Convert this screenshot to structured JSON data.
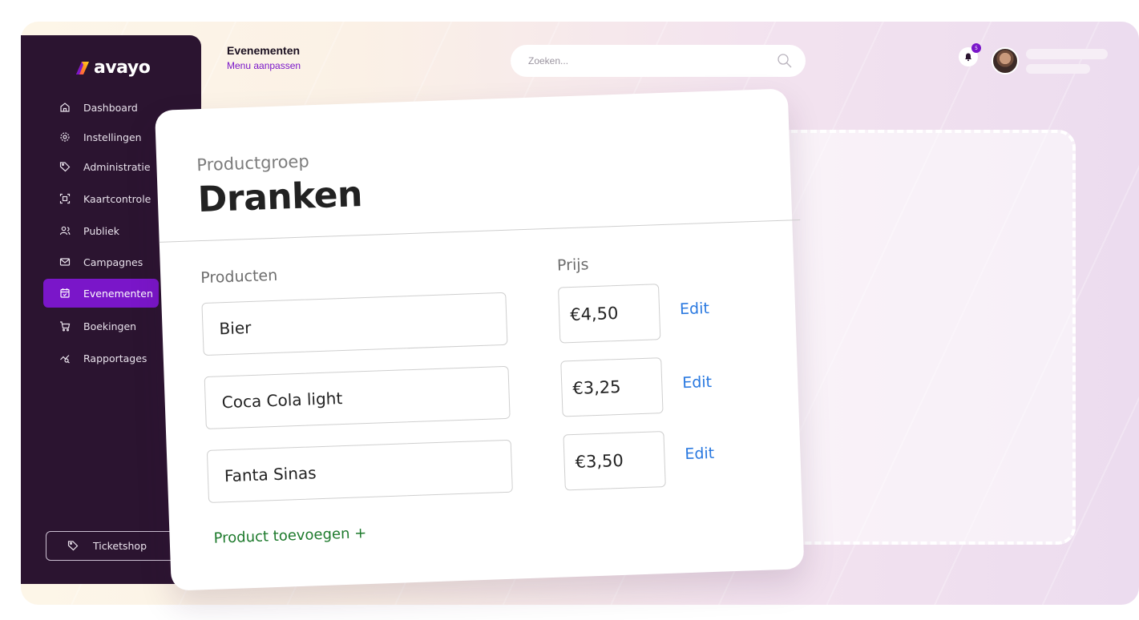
{
  "brand": {
    "name": "avayo"
  },
  "sidebar": {
    "items": [
      {
        "label": "Dashboard",
        "icon": "home-icon"
      },
      {
        "label": "Instellingen",
        "icon": "gear-icon"
      },
      {
        "label": "Administratie",
        "icon": "tag-icon"
      },
      {
        "label": "Kaartcontrole",
        "icon": "scan-icon"
      },
      {
        "label": "Publiek",
        "icon": "users-icon"
      },
      {
        "label": "Campagnes",
        "icon": "mail-icon"
      },
      {
        "label": "Evenementen",
        "icon": "calendar-icon",
        "active": true
      },
      {
        "label": "Boekingen",
        "icon": "cart-icon"
      },
      {
        "label": "Rapportages",
        "icon": "chart-icon"
      }
    ],
    "ticketshop_label": "Ticketshop"
  },
  "header": {
    "title": "Evenementen",
    "subtitle": "Menu aanpassen",
    "search_placeholder": "Zoeken...",
    "notification_count": "5"
  },
  "card": {
    "label": "Productgroep",
    "title": "Dranken",
    "col_products": "Producten",
    "col_price": "Prijs",
    "rows": [
      {
        "product": "Bier",
        "price": "€4,50",
        "action": "Edit"
      },
      {
        "product": "Coca Cola light",
        "price": "€3,25",
        "action": "Edit"
      },
      {
        "product": "Fanta Sinas",
        "price": "€3,50",
        "action": "Edit"
      }
    ],
    "add_label": "Product toevoegen +"
  },
  "colors": {
    "sidebar": "#2b1430",
    "accent": "#7a16c9",
    "edit": "#2a79e0",
    "add": "#1d7a2c"
  }
}
